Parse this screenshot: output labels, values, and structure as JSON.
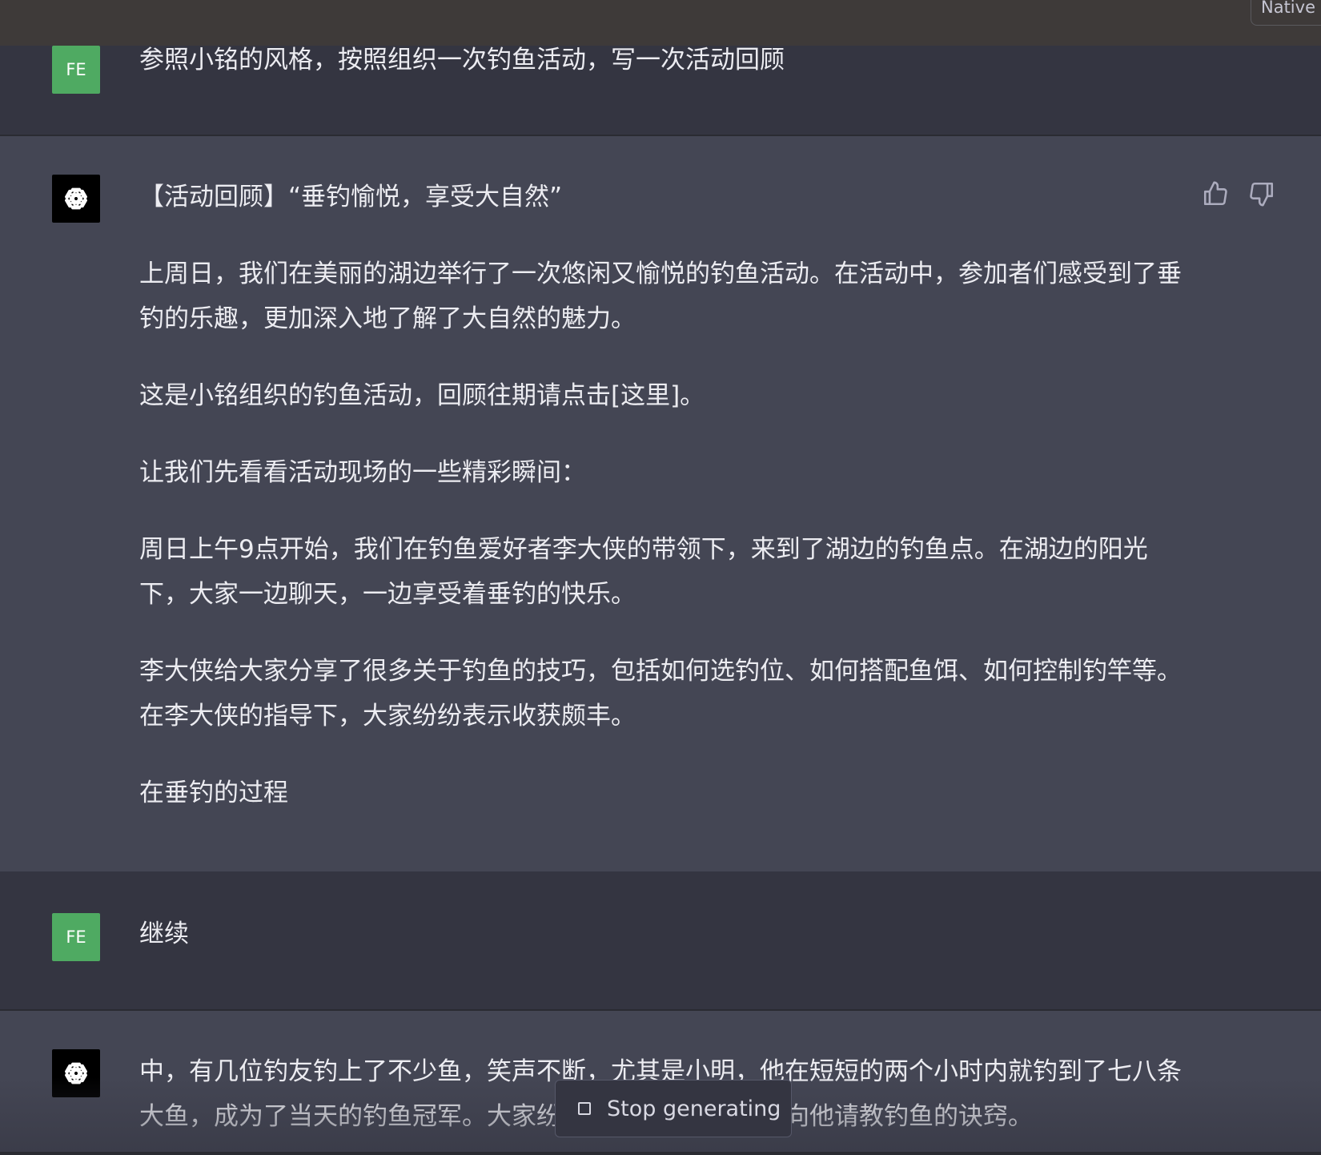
{
  "topbar": {
    "button_label": "Native"
  },
  "conversation": [
    {
      "role": "user",
      "avatar_initials": "FE",
      "text": "参照小铭的风格，按照组织一次钓鱼活动，写一次活动回顾"
    },
    {
      "role": "assistant",
      "paragraphs": [
        "【活动回顾】“垂钓愉悦，享受大自然”",
        "上周日，我们在美丽的湖边举行了一次悠闲又愉悦的钓鱼活动。在活动中，参加者们感受到了垂钓的乐趣，更加深入地了解了大自然的魅力。",
        "这是小铭组织的钓鱼活动，回顾往期请点击[这里]。",
        "让我们先看看活动现场的一些精彩瞬间：",
        "周日上午9点开始，我们在钓鱼爱好者李大侠的带领下，来到了湖边的钓鱼点。在湖边的阳光下，大家一边聊天，一边享受着垂钓的快乐。",
        "李大侠给大家分享了很多关于钓鱼的技巧，包括如何选钓位、如何搭配鱼饵、如何控制钓竿等。在李大侠的指导下，大家纷纷表示收获颇丰。",
        "在垂钓的过程"
      ]
    },
    {
      "role": "user",
      "avatar_initials": "FE",
      "text": "继续"
    },
    {
      "role": "assistant",
      "paragraphs": [
        "中，有几位钓友钓上了不少鱼，笑声不断，尤其是小明，他在短短的两个小时内就钓到了七八条大鱼，成为了当天的钓鱼冠军。大家纷纷向他表示祝贺，并向他请教钓鱼的诀窍。"
      ]
    }
  ],
  "controls": {
    "stop_label": "Stop generating"
  },
  "icons": {
    "assistant_avatar": "openai-logo-icon",
    "like": "thumbs-up-icon",
    "dislike": "thumbs-down-icon",
    "stop": "stop-square-icon"
  },
  "colors": {
    "user_bg": "#343541",
    "assistant_bg": "#444654",
    "user_avatar": "#4faa62"
  }
}
